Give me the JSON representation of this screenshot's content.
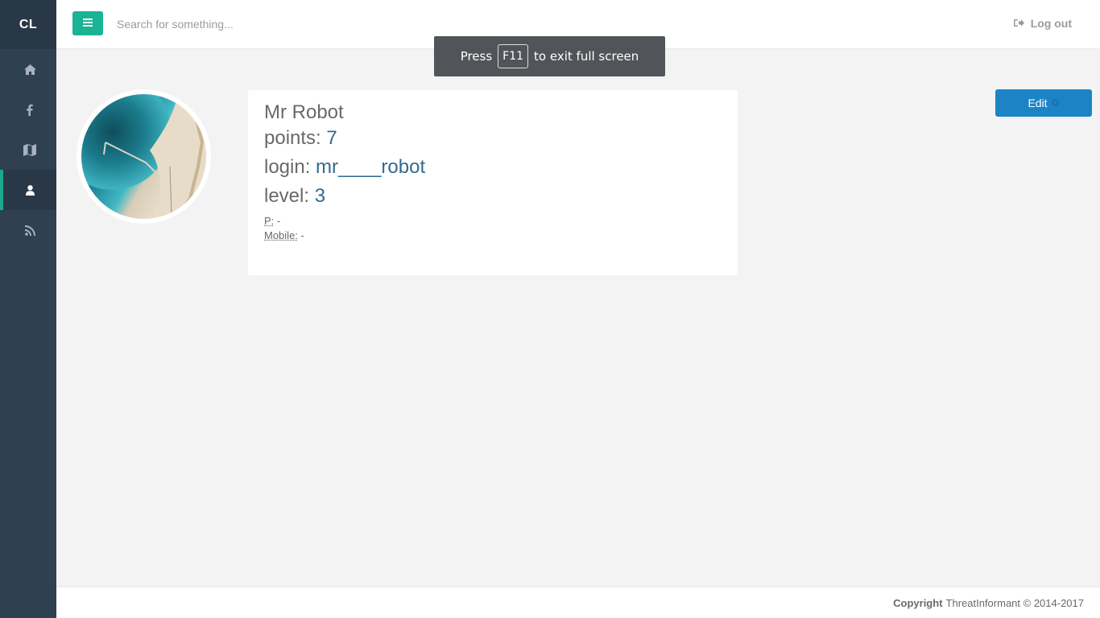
{
  "sidebar": {
    "brand": "CL",
    "items": [
      {
        "icon": "home-icon"
      },
      {
        "icon": "facebook-icon"
      },
      {
        "icon": "map-icon"
      },
      {
        "icon": "user-icon",
        "active": true
      },
      {
        "icon": "rss-icon"
      }
    ]
  },
  "topbar": {
    "search_placeholder": "Search for something...",
    "logout_label": "Log out"
  },
  "fullscreen_toast": {
    "before": "Press",
    "key": "F11",
    "after": "to exit full screen"
  },
  "profile": {
    "name": "Mr Robot",
    "points_label": "points:",
    "points_value": "7",
    "login_label": "login:",
    "login_value": "mr____robot",
    "level_label": "level:",
    "level_value": "3",
    "p_label": "P:",
    "p_value": "-",
    "mobile_label": "Mobile:",
    "mobile_value": "-"
  },
  "edit_label": "Edit",
  "footer": {
    "copyright_label": "Copyright",
    "copyright_text": "ThreatInformant © 2014-2017"
  },
  "colors": {
    "sidebar": "#2f4050",
    "accent": "#1ab394",
    "edit_button": "#1c84c6",
    "link_value": "#336a8e"
  }
}
